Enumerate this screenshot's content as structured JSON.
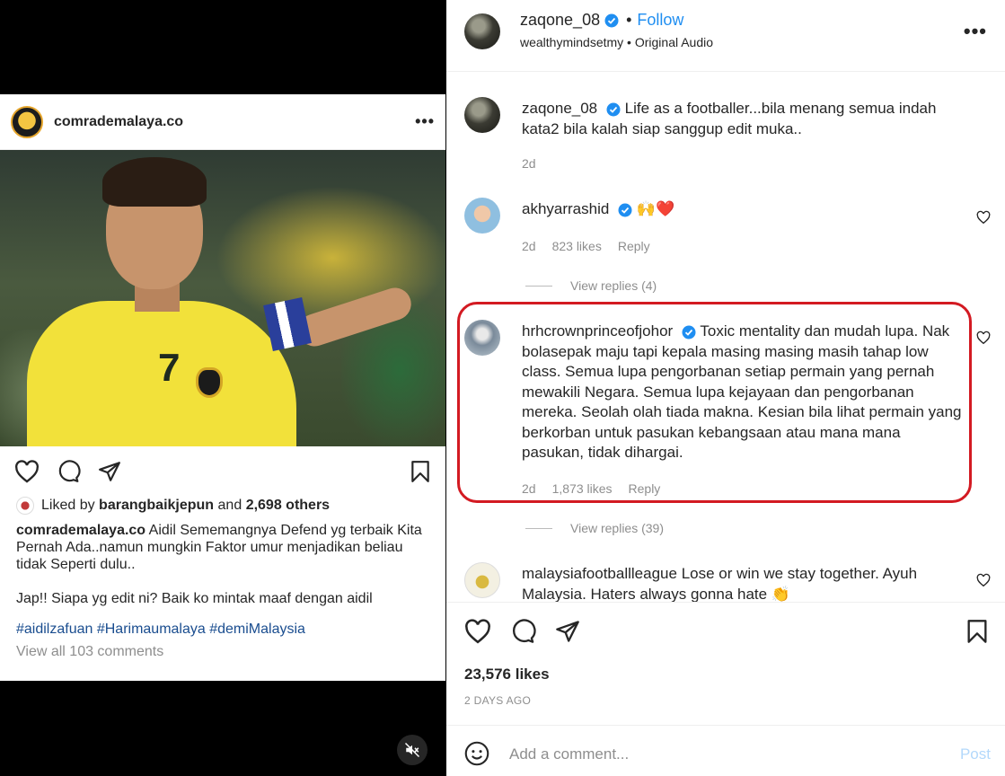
{
  "embed": {
    "username": "comrademalaya.co",
    "more": "•••",
    "liked_by_prefix": "Liked by",
    "liked_by_user": "barangbaikjepun",
    "liked_by_and": "and",
    "liked_by_others": "2,698 others",
    "caption_user": "comrademalaya.co",
    "caption_text": "Aidil Sememangnya Defend yg terbaik Kita Pernah Ada..namun mungkin Faktor umur menjadikan beliau tidak Seperti dulu..\n\nJap!! Siapa yg edit ni?  Baik ko mintak maaf dengan aidil",
    "hashtags": "#aidilzafuan #Harimaumalaya #demiMalaysia",
    "view_all": "View all 103 comments",
    "jersey_number": "7"
  },
  "header": {
    "username": "zaqone_08",
    "follow": "Follow",
    "audio_account": "wealthymindsetmy",
    "audio_sep": "•",
    "audio_label": "Original Audio",
    "more": "•••"
  },
  "comments": [
    {
      "user": "zaqone_08",
      "text": "Life as a footballer...bila menang semua indah kata2 bila kalah siap sanggup edit muka..",
      "age": "2d"
    },
    {
      "user": "akhyarrashid",
      "text": "🙌❤️",
      "age": "2d",
      "likes": "823 likes",
      "reply": "Reply",
      "view_replies": "View replies (4)"
    },
    {
      "user": "hrhcrownprinceofjohor",
      "text": "Toxic mentality dan mudah lupa. Nak bolasepak maju tapi kepala masing masing masih tahap low class. Semua lupa pengorbanan setiap permain yang pernah mewakili Negara. Semua lupa kejayaan dan pengorbanan mereka. Seolah olah tiada makna. Kesian bila lihat permain yang berkorban untuk pasukan kebangsaan atau mana mana pasukan, tidak dihargai.",
      "age": "2d",
      "likes": "1,873 likes",
      "reply": "Reply",
      "view_replies": "View replies (39)"
    },
    {
      "user": "malaysiafootballleague",
      "text": "Lose or win we stay together. Ayuh Malaysia. Haters always gonna hate 👏"
    }
  ],
  "post": {
    "likes": "23,576 likes",
    "time_ago": "2 DAYS AGO"
  },
  "add_comment": {
    "placeholder": "Add a comment...",
    "post_label": "Post"
  },
  "colors": {
    "link_blue": "#1f8ef1",
    "highlight_red": "#d31a22",
    "post_disabled": "#b3d8fb"
  },
  "icons": [
    "heart-icon",
    "comment-icon",
    "share-icon",
    "bookmark-icon",
    "mute-icon",
    "verified-icon",
    "emoji-icon",
    "more-icon"
  ]
}
